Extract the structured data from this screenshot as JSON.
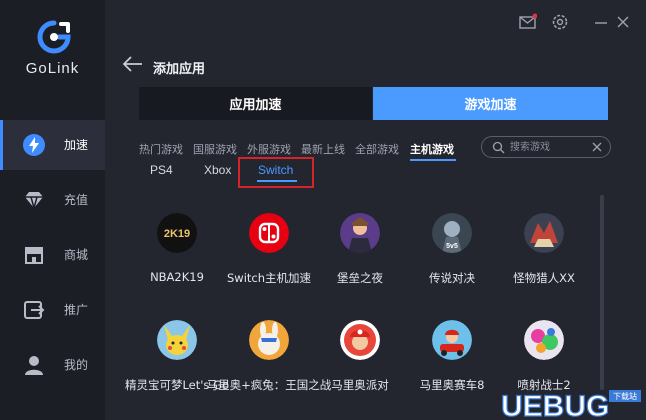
{
  "app": {
    "brand": "GoLink",
    "brand_color": "#3f8cff",
    "accent_color": "#4b9bff"
  },
  "window_controls": {
    "icons": [
      "mail-icon",
      "settings-icon",
      "minimize-icon",
      "close-icon"
    ]
  },
  "sidebar": {
    "items": [
      {
        "label": "加速",
        "icon": "lightning-icon",
        "active": true
      },
      {
        "label": "充值",
        "icon": "diamond-icon",
        "active": false
      },
      {
        "label": "商城",
        "icon": "store-icon",
        "active": false
      },
      {
        "label": "推广",
        "icon": "share-icon",
        "active": false
      },
      {
        "label": "我的",
        "icon": "user-icon",
        "active": false
      }
    ]
  },
  "header": {
    "title": "添加应用"
  },
  "segments": {
    "app_label": "应用加速",
    "game_label": "游戏加速",
    "selected": "游戏加速"
  },
  "categories": {
    "items": [
      "热门游戏",
      "国服游戏",
      "外服游戏",
      "最新上线",
      "全部游戏",
      "主机游戏"
    ],
    "selected": "主机游戏"
  },
  "search": {
    "placeholder": "搜索游戏",
    "value": ""
  },
  "platforms": {
    "items": [
      "PS4",
      "Xbox",
      "Switch"
    ],
    "selected": "Switch",
    "highlight_color": "#d4232a"
  },
  "games": [
    {
      "name": "NBA2K19",
      "icon": "nba2k19-icon"
    },
    {
      "name": "Switch主机加速",
      "icon": "switch-logo-icon"
    },
    {
      "name": "堡垒之夜",
      "icon": "fortnite-icon"
    },
    {
      "name": "传说对决",
      "icon": "arena-of-valor-icon"
    },
    {
      "name": "怪物猎人XX",
      "icon": "monster-hunter-icon"
    },
    {
      "name": "精灵宝可梦Let's Go",
      "icon": "pikachu-icon"
    },
    {
      "name": "马里奥+疯兔：王国之战",
      "icon": "mario-rabbids-icon"
    },
    {
      "name": "马里奥派对",
      "icon": "mario-party-icon"
    },
    {
      "name": "马里奥赛车8",
      "icon": "mario-kart-icon"
    },
    {
      "name": "喷射战士2",
      "icon": "splatoon-icon"
    }
  ],
  "watermark": {
    "text": "UEBUG",
    "tag": "下载站"
  }
}
